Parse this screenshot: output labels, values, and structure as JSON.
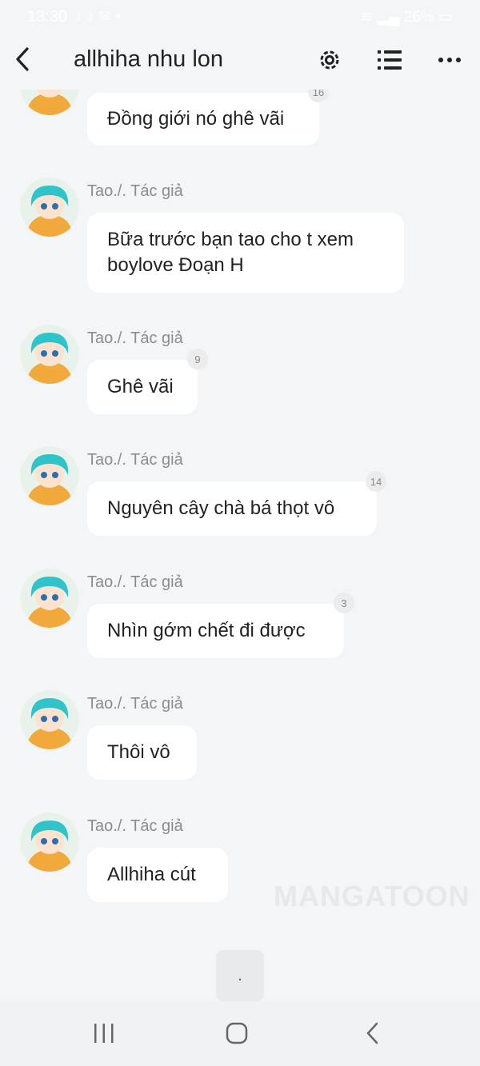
{
  "status_bar": {
    "time": "13:30",
    "battery": "26%",
    "app_icons": [
      "tiktok-icon",
      "tiktok-icon",
      "capcut-icon",
      "dot-icon"
    ]
  },
  "header": {
    "title": "allhiha nhu lon"
  },
  "messages": [
    {
      "author": "",
      "text": "Đồng giới nó ghê vãi",
      "count": "16"
    },
    {
      "author": "Tao./. Tác giả",
      "text": "Bữa trước bạn tao cho t xem boylove Đoạn H",
      "count": ""
    },
    {
      "author": "Tao./. Tác giả",
      "text": "Ghê vãi",
      "count": "9"
    },
    {
      "author": "Tao./. Tác giả",
      "text": "Nguyên cây chà bá thọt vô",
      "count": "14"
    },
    {
      "author": "Tao./. Tác giả",
      "text": "Nhìn gớm chết đi được",
      "count": "3"
    },
    {
      "author": "Tao./. Tác giả",
      "text": "Thôi vô",
      "count": ""
    },
    {
      "author": "Tao./. Tác giả",
      "text": "Allhiha cút",
      "count": ""
    }
  ],
  "watermark": "MANGATOON",
  "composer": {
    "text": "."
  },
  "colors": {
    "background": "#f4f5f7",
    "bubble": "#ffffff",
    "name": "#8c8c8c",
    "avatar_hair": "#2fc4c9",
    "avatar_body": "#f2a93b"
  }
}
